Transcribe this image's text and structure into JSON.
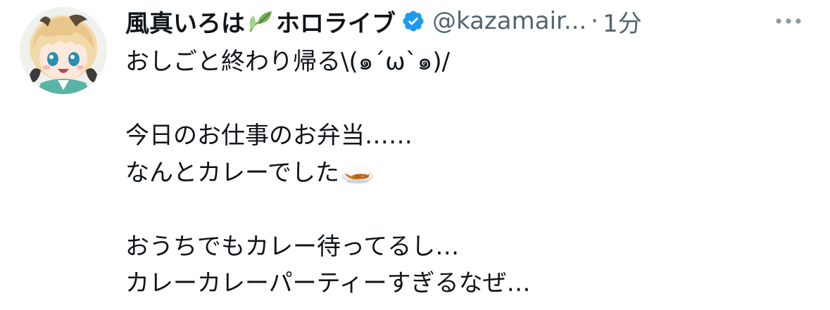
{
  "tweet": {
    "author": {
      "name_part1": "風真いろは",
      "name_part2": "ホロライブ",
      "handle": "@kazamair...",
      "separator": "·",
      "timestamp": "1分",
      "verified_color": "#1d9bf0",
      "emoji_icon": "leaf-icon"
    },
    "lines": [
      "おしごと終わり帰る\\(๑´ω`๑)/",
      "",
      "今日のお仕事のお弁当……",
      "なんとカレーでした",
      "",
      "おうちでもカレー待ってるし…",
      "カレーカレーパーティーすぎるなぜ…"
    ],
    "inline_emoji": "curry-rice-icon",
    "more_icon": "more-options-icon"
  },
  "colors": {
    "text": "#0f1419",
    "secondary": "#536471",
    "accent": "#1d9bf0"
  }
}
